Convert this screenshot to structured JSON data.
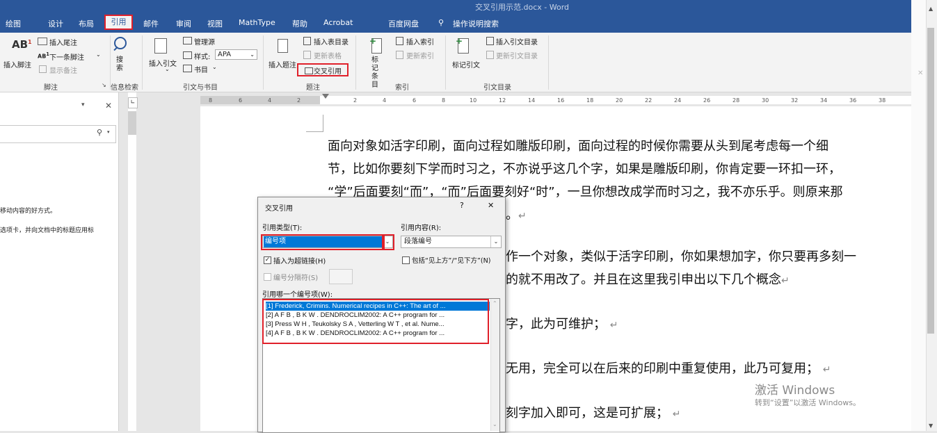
{
  "window": {
    "title": "交叉引用示范.docx  -  Word"
  },
  "tabs": [
    "绘图",
    "设计",
    "布局",
    "引用",
    "邮件",
    "审阅",
    "视图",
    "MathType",
    "帮助",
    "Acrobat",
    "百度网盘",
    "操作说明搜索"
  ],
  "active_tab": "引用",
  "ribbon": {
    "footnotes": {
      "insert_footnote": "插入脚注",
      "insert_endnote": "插入尾注",
      "next_footnote": "下一条脚注",
      "show_notes": "显示备注",
      "group": "脚注"
    },
    "research": {
      "search": "搜索",
      "group": "信息检索"
    },
    "citations": {
      "insert_citation": "插入引文",
      "manage_sources": "管理源",
      "style_label": "样式:",
      "style_value": "APA",
      "bibliography": "书目",
      "group": "引文与书目"
    },
    "captions": {
      "insert_caption": "插入题注",
      "insert_table_of_figures": "插入表目录",
      "update_table": "更新表格",
      "cross_reference": "交叉引用",
      "group": "题注"
    },
    "index": {
      "mark_entry": "标记条目",
      "insert_index": "插入索引",
      "update_index": "更新索引",
      "group": "索引"
    },
    "toa": {
      "mark_citation": "标记引文",
      "insert_toa": "插入引文目录",
      "update_toa": "更新引文目录",
      "group": "引文目录"
    }
  },
  "nav_pane": {
    "line1": "移动内容的好方式。",
    "line2": "选项卡，并向文档中的标题应用标"
  },
  "ruler": {
    "left_numbers": [
      "8",
      "6",
      "4",
      "2"
    ],
    "right_numbers": [
      "2",
      "4",
      "6",
      "8",
      "10",
      "12",
      "14",
      "16",
      "18",
      "20",
      "22",
      "24",
      "26",
      "28",
      "30",
      "32",
      "34",
      "36",
      "38"
    ]
  },
  "document": {
    "p1_l1": "面向对象如活字印刷，面向过程如雕版印刷，面向过程的时候你需要从头到尾考虑每一个细",
    "p1_l2": "节，比如你要刻下学而时习之，不亦说乎这几个字，如果是雕版印刷，你肯定要一环扣一环，",
    "p1_l3": "“学”后面要刻“而”，“而”后面要刻好“时”，一旦你想改成学而时习之，我不亦乐乎。则原来那",
    "p1_l4": "。",
    "p2_l1": "作一个对象，类似于活字印刷，你如果想加字，你只要再多刻一",
    "p2_l2": "的就不用改了。并且在这里我引申出以下几个概念",
    "p3": "字，此为可维护；",
    "p4": "无用，完全可以在后来的印刷中重复使用，此乃可复用；",
    "p5": "刻字加入即可，这是可扩展；"
  },
  "dialog": {
    "title": "交叉引用",
    "help": "?",
    "close": "✕",
    "ref_type_label": "引用类型(T):",
    "ref_type_value": "编号项",
    "ref_content_label": "引用内容(R):",
    "ref_content_value": "段落编号",
    "insert_hyperlink_label": "插入为超链接(H)",
    "insert_hyperlink_checked": true,
    "include_above_below_label": "包括“见上方”/“见下方”(N)",
    "separator_label": "编号分隔符(S)",
    "which_item_label": "引用哪一个编号项(W):",
    "items": [
      "[1] Frederick, Crimins. Numerical recipes in C++: The art of ...",
      "[2] A F B ,  B K W . DENDROCLIM2002: A C++ program for ...",
      "[3] Press W H ,  Teukolsky S A ,  Vetterling W T , et al. Nume...",
      "[4] A F B ,  B K W . DENDROCLIM2002: A C++ program for ..."
    ],
    "selected_index": 0
  },
  "watermark": {
    "line1": "激活 Windows",
    "line2": "转到“设置”以激活 Windows。"
  },
  "colors": {
    "word_blue": "#2b579a",
    "highlight_red": "#e0202a",
    "selection_blue": "#0078d7"
  }
}
